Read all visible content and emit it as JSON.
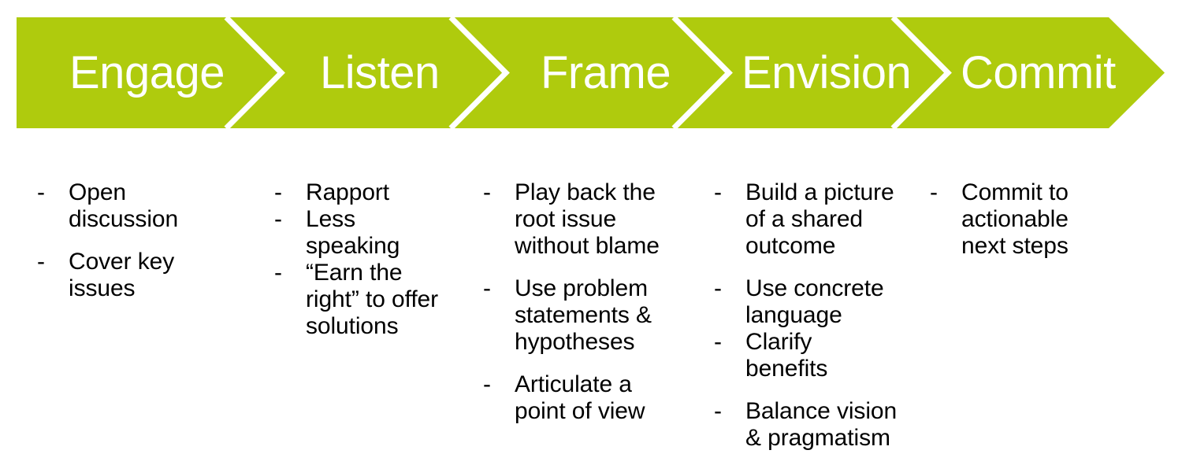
{
  "theme": {
    "chevron_color": "#AFCB0D",
    "chevron_label_color": "#FFFFFF",
    "background_color": "#FFFFFF",
    "body_text_color": "#000000",
    "separator_color": "#FFFFFF"
  },
  "process": {
    "stages": [
      {
        "label": "Engage"
      },
      {
        "label": "Listen"
      },
      {
        "label": "Frame"
      },
      {
        "label": "Envision"
      },
      {
        "label": "Commit"
      }
    ]
  },
  "columns": [
    {
      "stage": "Engage",
      "bullets": [
        {
          "marker": "-",
          "text": "Open discussion"
        },
        {
          "marker": "-",
          "text": "Cover key issues"
        }
      ]
    },
    {
      "stage": "Listen",
      "bullets": [
        {
          "marker": "-",
          "text": "Rapport"
        },
        {
          "marker": "-",
          "text": "Less speaking"
        },
        {
          "marker": "-",
          "text": "“Earn the right” to offer solutions"
        }
      ]
    },
    {
      "stage": "Frame",
      "bullets": [
        {
          "marker": "-",
          "text": "Play back the root issue without blame"
        },
        {
          "marker": "-",
          "text": "Use problem statements & hypotheses"
        },
        {
          "marker": "-",
          "text": "Articulate a point of view"
        }
      ]
    },
    {
      "stage": "Envision",
      "bullets": [
        {
          "marker": "-",
          "text": "Build a picture of a shared outcome"
        },
        {
          "marker": "-",
          "text": "Use concrete language"
        },
        {
          "marker": "-",
          "text": "Clarify benefits"
        },
        {
          "marker": "-",
          "text": "Balance vision & pragmatism"
        }
      ]
    },
    {
      "stage": "Commit",
      "bullets": [
        {
          "marker": "-",
          "text": "Commit to actionable next steps"
        }
      ]
    }
  ]
}
